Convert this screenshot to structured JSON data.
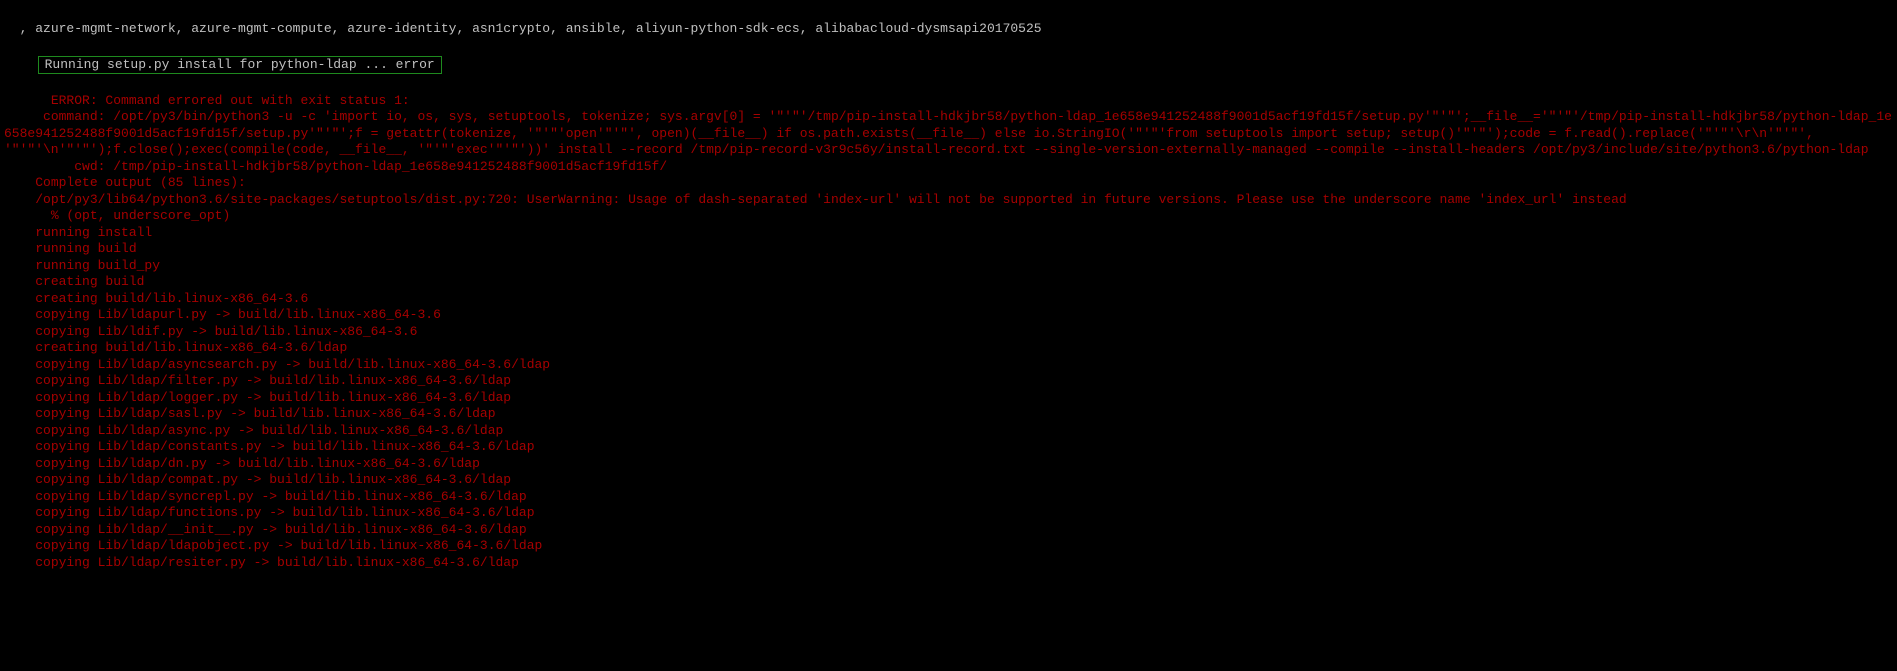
{
  "header": {
    "packages": ", azure-mgmt-network, azure-mgmt-compute, azure-identity, asn1crypto, ansible, aliyun-python-sdk-ecs, alibabacloud-dysmsapi20170525"
  },
  "box": {
    "text": "Running setup.py install for python-ldap ... error"
  },
  "lines": [
    "    ERROR: Command errored out with exit status 1:",
    "     command: /opt/py3/bin/python3 -u -c 'import io, os, sys, setuptools, tokenize; sys.argv[0] = '\"'\"'/tmp/pip-install-hdkjbr58/python-ldap_1e658e941252488f9001d5acf19fd15f/setup.py'\"'\"';__file__='\"'\"'/tmp/pip-install-hdkjbr58/python-ldap_1e658e941252488f9001d5acf19fd15f/setup.py'\"'\"';f = getattr(tokenize, '\"'\"'open'\"'\"', open)(__file__) if os.path.exists(__file__) else io.StringIO('\"'\"'from setuptools import setup; setup()'\"'\"');code = f.read().replace('\"'\"'\\r\\n'\"'\"', '\"'\"'\\n'\"'\"');f.close();exec(compile(code, __file__, '\"'\"'exec'\"'\"'))' install --record /tmp/pip-record-v3r9c56y/install-record.txt --single-version-externally-managed --compile --install-headers /opt/py3/include/site/python3.6/python-ldap",
    "         cwd: /tmp/pip-install-hdkjbr58/python-ldap_1e658e941252488f9001d5acf19fd15f/",
    "    Complete output (85 lines):",
    "    /opt/py3/lib64/python3.6/site-packages/setuptools/dist.py:720: UserWarning: Usage of dash-separated 'index-url' will not be supported in future versions. Please use the underscore name 'index_url' instead",
    "      % (opt, underscore_opt)",
    "    running install",
    "    running build",
    "    running build_py",
    "    creating build",
    "    creating build/lib.linux-x86_64-3.6",
    "    copying Lib/ldapurl.py -> build/lib.linux-x86_64-3.6",
    "    copying Lib/ldif.py -> build/lib.linux-x86_64-3.6",
    "    creating build/lib.linux-x86_64-3.6/ldap",
    "    copying Lib/ldap/asyncsearch.py -> build/lib.linux-x86_64-3.6/ldap",
    "    copying Lib/ldap/filter.py -> build/lib.linux-x86_64-3.6/ldap",
    "    copying Lib/ldap/logger.py -> build/lib.linux-x86_64-3.6/ldap",
    "    copying Lib/ldap/sasl.py -> build/lib.linux-x86_64-3.6/ldap",
    "    copying Lib/ldap/async.py -> build/lib.linux-x86_64-3.6/ldap",
    "    copying Lib/ldap/constants.py -> build/lib.linux-x86_64-3.6/ldap",
    "    copying Lib/ldap/dn.py -> build/lib.linux-x86_64-3.6/ldap",
    "    copying Lib/ldap/compat.py -> build/lib.linux-x86_64-3.6/ldap",
    "    copying Lib/ldap/syncrepl.py -> build/lib.linux-x86_64-3.6/ldap",
    "    copying Lib/ldap/functions.py -> build/lib.linux-x86_64-3.6/ldap",
    "    copying Lib/ldap/__init__.py -> build/lib.linux-x86_64-3.6/ldap",
    "    copying Lib/ldap/ldapobject.py -> build/lib.linux-x86_64-3.6/ldap",
    "    copying Lib/ldap/resiter.py -> build/lib.linux-x86_64-3.6/ldap"
  ]
}
